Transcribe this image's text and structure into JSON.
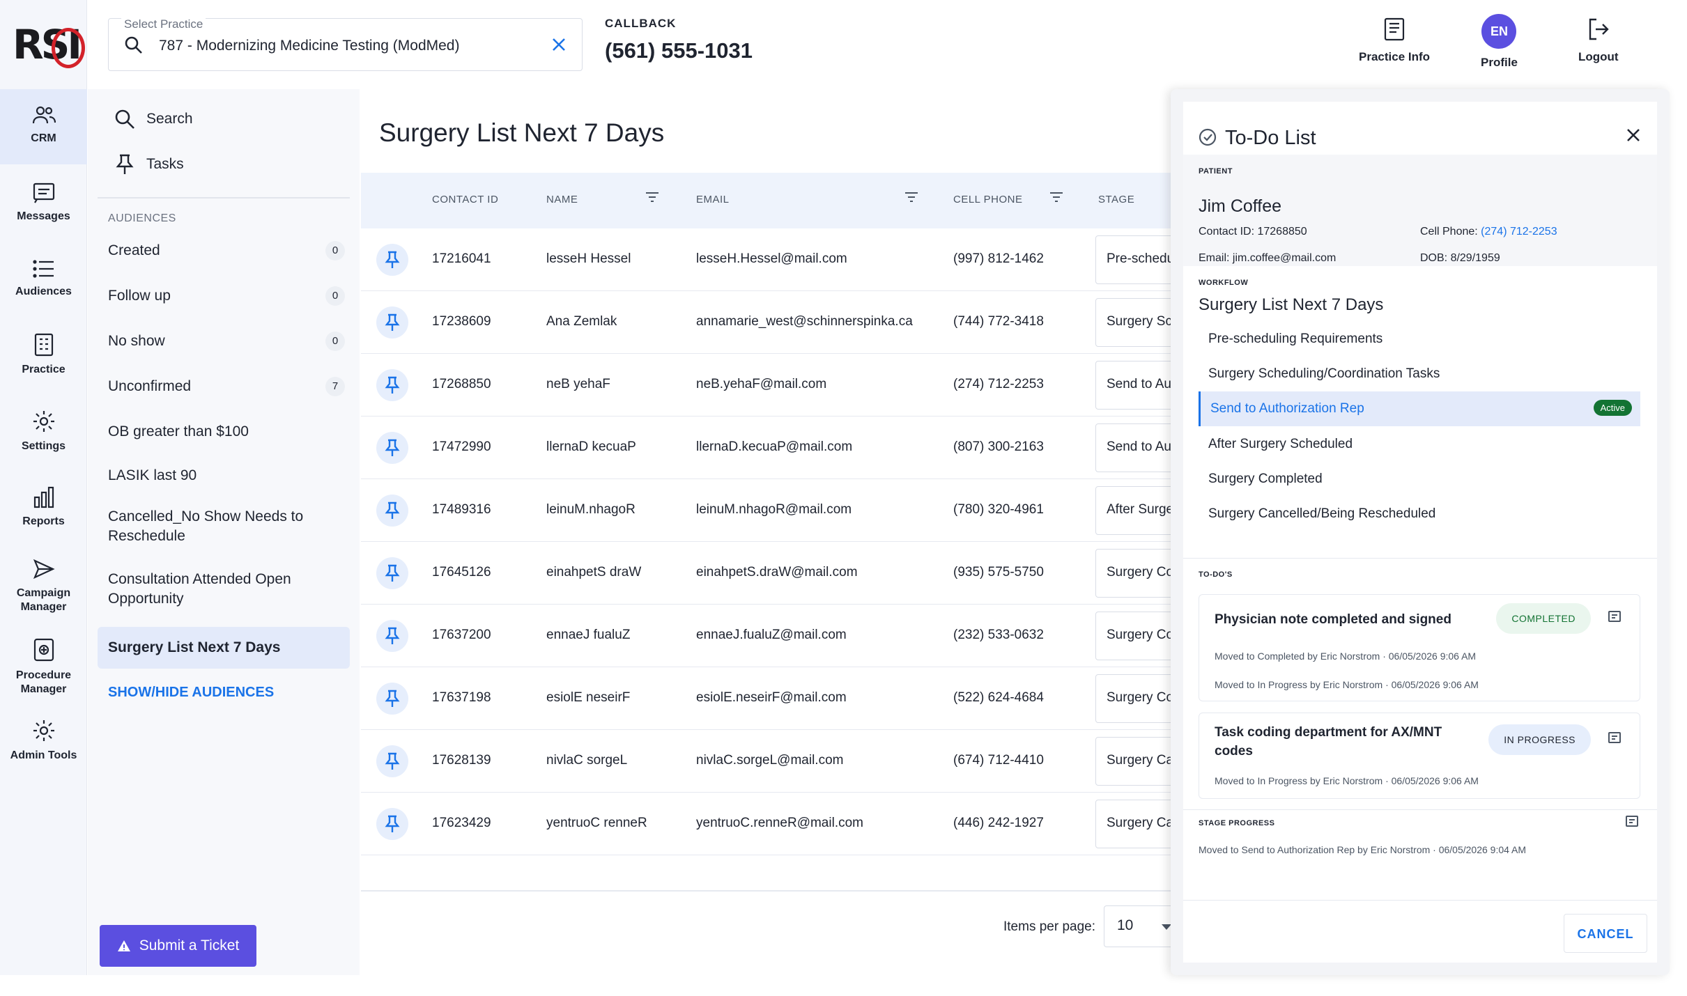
{
  "header": {
    "practice_label": "Select Practice",
    "practice_value": "787 - Modernizing Medicine Testing (ModMed)",
    "callback_label": "CALLBACK",
    "callback_number": "(561) 555-1031",
    "actions": [
      {
        "label": "Practice Info",
        "icon": "book-icon"
      },
      {
        "label": "Profile",
        "initials": "EN"
      },
      {
        "label": "Logout",
        "icon": "logout-icon"
      }
    ]
  },
  "rail": {
    "logo": "RSI",
    "items": [
      {
        "label": "CRM",
        "icon": "people-icon",
        "active": true
      },
      {
        "label": "Messages",
        "icon": "message-icon"
      },
      {
        "label": "Audiences",
        "icon": "list-icon"
      },
      {
        "label": "Practice",
        "icon": "building-icon"
      },
      {
        "label": "Settings",
        "icon": "gear-icon"
      },
      {
        "label": "Reports",
        "icon": "bar-chart-icon"
      },
      {
        "label": "Campaign Manager",
        "icon": "send-icon"
      },
      {
        "label": "Procedure Manager",
        "icon": "procedure-icon"
      },
      {
        "label": "Admin Tools",
        "icon": "gear-icon"
      }
    ]
  },
  "sidebar": {
    "search_label": "Search",
    "tasks_label": "Tasks",
    "audiences_heading": "AUDIENCES",
    "audiences": [
      {
        "label": "Created",
        "count": "0"
      },
      {
        "label": "Follow up",
        "count": "0"
      },
      {
        "label": "No show",
        "count": "0"
      },
      {
        "label": "Unconfirmed",
        "count": "7"
      },
      {
        "label": "OB greater than $100"
      },
      {
        "label": "LASIK last 90"
      },
      {
        "label": "Cancelled_No Show Needs to Reschedule"
      },
      {
        "label": "Consultation Attended Open Opportunity"
      },
      {
        "label": "Surgery List Next 7 Days",
        "selected": true
      }
    ],
    "show_hide_label": "SHOW/HIDE AUDIENCES",
    "ticket_label": "Submit a Ticket"
  },
  "main": {
    "title": "Surgery List Next 7 Days",
    "columns": [
      "CONTACT ID",
      "NAME",
      "EMAIL",
      "CELL PHONE",
      "STAGE"
    ],
    "rows": [
      {
        "id": "17216041",
        "name": "lesseH Hessel",
        "email": "lesseH.Hessel@mail.com",
        "phone": "(997) 812-1462",
        "stage": "Pre-scheduling Requirements"
      },
      {
        "id": "17238609",
        "name": "Ana Zemlak",
        "email": "annamarie_west@schinnerspinka.ca",
        "phone": "(744) 772-3418",
        "stage": "Surgery Scheduling/Coordination Tasks"
      },
      {
        "id": "17268850",
        "name": "neB yehaF",
        "email": "neB.yehaF@mail.com",
        "phone": "(274) 712-2253",
        "stage": "Send to Authorization Rep"
      },
      {
        "id": "17472990",
        "name": "llernaD kecuaP",
        "email": "llernaD.kecuaP@mail.com",
        "phone": "(807) 300-2163",
        "stage": "Send to Authorization Rep"
      },
      {
        "id": "17489316",
        "name": "leinuM.nhagoR",
        "email": "leinuM.nhagoR@mail.com",
        "phone": "(780) 320-4961",
        "stage": "After Surgery Scheduled"
      },
      {
        "id": "17645126",
        "name": "einahpetS draW",
        "email": "einahpetS.draW@mail.com",
        "phone": "(935) 575-5750",
        "stage": "Surgery Completed"
      },
      {
        "id": "17637200",
        "name": "ennaeJ fualuZ",
        "email": "ennaeJ.fualuZ@mail.com",
        "phone": "(232) 533-0632",
        "stage": "Surgery Completed"
      },
      {
        "id": "17637198",
        "name": "esiolE neseirF",
        "email": "esiolE.neseirF@mail.com",
        "phone": "(522) 624-4684",
        "stage": "Surgery Completed"
      },
      {
        "id": "17628139",
        "name": "nivlaC sorgeL",
        "email": "nivlaC.sorgeL@mail.com",
        "phone": "(674) 712-4410",
        "stage": "Surgery Cancelled/Being Rescheduled"
      },
      {
        "id": "17623429",
        "name": "yentruoC renneR",
        "email": "yentruoC.renneR@mail.com",
        "phone": "(446) 242-1927",
        "stage": "Surgery Cancelled/Being Rescheduled"
      }
    ],
    "items_per_page_label": "Items per page:",
    "items_per_page": "10"
  },
  "todo": {
    "title": "To-Do List",
    "patient_heading": "PATIENT",
    "patient_name": "Jim Coffee",
    "contact_id": "Contact ID: 17268850",
    "cell_label": "Cell Phone:",
    "cell_value": "(274) 712-2253",
    "email": "Email: jim.coffee@mail.com",
    "dob": "DOB: 8/29/1959",
    "workflow_heading": "WORKFLOW",
    "workflow_title": "Surgery List Next 7 Days",
    "workflow_steps": [
      {
        "label": "Pre-scheduling Requirements"
      },
      {
        "label": "Surgery Scheduling/Coordination Tasks"
      },
      {
        "label": "Send to Authorization Rep",
        "active": true,
        "badge": "Active"
      },
      {
        "label": "After Surgery Scheduled"
      },
      {
        "label": "Surgery Completed"
      },
      {
        "label": "Surgery Cancelled/Being Rescheduled"
      }
    ],
    "todos_heading": "TO-DO'S",
    "todos": [
      {
        "title": "Physician note completed and signed",
        "status": "COMPLETED",
        "log": [
          "Moved to Completed by Eric Norstrom · 06/05/2026 9:06 AM",
          "Moved to In Progress by Eric Norstrom · 06/05/2026 9:06 AM"
        ]
      },
      {
        "title": "Task coding department for AX/MNT codes",
        "status": "IN PROGRESS",
        "log": [
          "Moved to In Progress by Eric Norstrom · 06/05/2026 9:06 AM"
        ]
      }
    ],
    "stage_progress_heading": "STAGE PROGRESS",
    "stage_progress_log": "Moved to Send to Authorization Rep by Eric Norstrom · 06/05/2026 9:04 AM",
    "cancel_label": "CANCEL"
  },
  "colors": {
    "accent": "#1a73e8",
    "brand_purple": "#5b4fe0",
    "logo_red": "#d3222a",
    "active_badge": "#137333"
  }
}
